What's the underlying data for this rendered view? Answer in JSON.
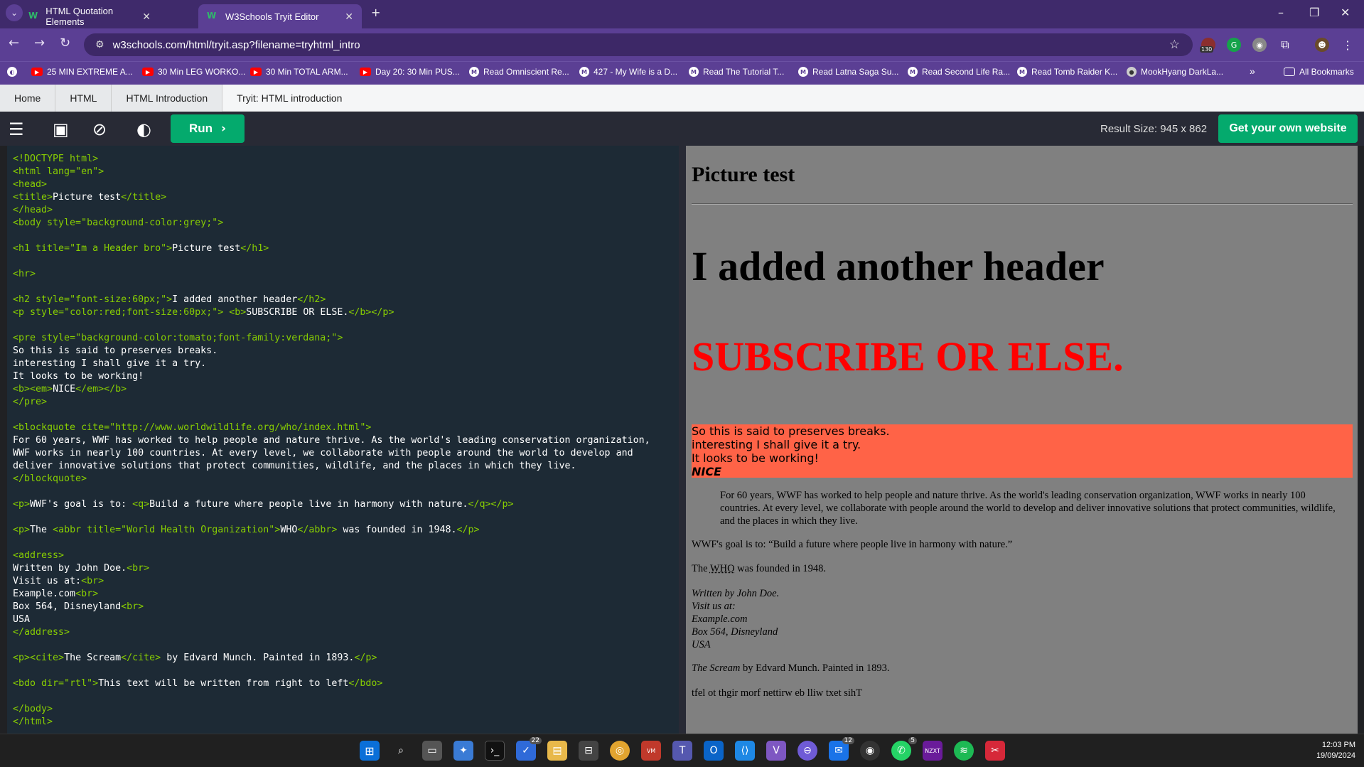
{
  "tabs": [
    {
      "label": "HTML Quotation Elements",
      "active": false
    },
    {
      "label": "W3Schools Tryit Editor",
      "active": true
    }
  ],
  "window_controls": {
    "new_tab": "+",
    "minimize": "–",
    "restore": "❐",
    "close": "✕"
  },
  "toolbar": {
    "url": "w3schools.com/html/tryit.asp?filename=tryhtml_intro",
    "extension_badge": "130"
  },
  "bookmarks": [
    {
      "label": "25 MIN EXTREME A...",
      "icon": "youtube-icon"
    },
    {
      "label": "30 Min LEG WORKO...",
      "icon": "youtube-icon"
    },
    {
      "label": "30 Min TOTAL ARM...",
      "icon": "youtube-icon"
    },
    {
      "label": "Day 20: 30 Min PUS...",
      "icon": "youtube-icon"
    },
    {
      "label": "Read Omniscient Re...",
      "icon": "manga-icon"
    },
    {
      "label": "427 - My Wife is a D...",
      "icon": "manga-icon"
    },
    {
      "label": "Read The Tutorial T...",
      "icon": "manga-icon"
    },
    {
      "label": "Read Latna Saga Su...",
      "icon": "manga-icon"
    },
    {
      "label": "Read Second Life Ra...",
      "icon": "manga-icon"
    },
    {
      "label": "Read Tomb Raider K...",
      "icon": "manga-icon"
    },
    {
      "label": "MookHyang DarkLa...",
      "icon": "site-icon"
    }
  ],
  "bookmarks_overflow": "»",
  "all_bookmarks": "All Bookmarks",
  "breadcrumb": [
    "Home",
    "HTML",
    "HTML Introduction",
    "Tryit: HTML introduction"
  ],
  "editor": {
    "run_label": "Run",
    "result_size": "Result Size: 945 x 862",
    "get_website": "Get your own website"
  },
  "code_lines": [
    "<!DOCTYPE html>",
    "<html lang=\"en\">",
    "<head>",
    "<title>Picture test</title>",
    "</head>",
    "<body style=\"background-color:grey;\">",
    "",
    "<h1 title=\"Im a Header bro\">Picture test</h1>",
    "",
    "<hr>",
    "",
    "<h2 style=\"font-size:60px;\">I added another header</h2>",
    "<p style=\"color:red;font-size:60px;\"> <b>SUBSCRIBE OR ELSE.</b></p>",
    "",
    "<pre style=\"background-color:tomato;font-family:verdana;\">",
    "So this is said to preserves breaks.",
    "interesting I shall give it a try.",
    "It looks to be working!",
    "<b><em>NICE</em></b>",
    "</pre>",
    "",
    "<blockquote cite=\"http://www.worldwildlife.org/who/index.html\">",
    "For 60 years, WWF has worked to help people and nature thrive. As the world's leading conservation organization,",
    "WWF works in nearly 100 countries. At every level, we collaborate with people around the world to develop and",
    "deliver innovative solutions that protect communities, wildlife, and the places in which they live.",
    "</blockquote>",
    "",
    "<p>WWF's goal is to: <q>Build a future where people live in harmony with nature.</q></p>",
    "",
    "<p>The <abbr title=\"World Health Organization\">WHO</abbr> was founded in 1948.</p>",
    "",
    "<address>",
    "Written by John Doe.<br>",
    "Visit us at:<br>",
    "Example.com<br>",
    "Box 564, Disneyland<br>",
    "USA",
    "</address>",
    "",
    "<p><cite>The Scream</cite> by Edvard Munch. Painted in 1893.</p>",
    "",
    "<bdo dir=\"rtl\">This text will be written from right to left</bdo>",
    "",
    "</body>",
    "</html>"
  ],
  "result": {
    "h1": "Picture test",
    "h2": "I added another header",
    "subscribe": "SUBSCRIBE OR ELSE.",
    "pre_lines": [
      "So this is said to preserves breaks.",
      "interesting I shall give it a try.",
      "It looks to be working!"
    ],
    "pre_nice": "NICE",
    "blockquote": "For 60 years, WWF has worked to help people and nature thrive. As the world's leading conservation organization, WWF works in nearly 100 countries. At every level, we collaborate with people around the world to develop and deliver innovative solutions that protect communities, wildlife, and the places in which they live.",
    "goal_prefix": "WWF's goal is to: ",
    "goal_quote": "“Build a future where people live in harmony with nature.”",
    "who_prefix": "The ",
    "who_abbr": "WHO",
    "who_suffix": " was founded in 1948.",
    "address": [
      "Written by John Doe.",
      "Visit us at:",
      "Example.com",
      "Box 564, Disneyland",
      "USA"
    ],
    "cite": "The Scream",
    "cite_suffix": " by Edvard Munch. Painted in 1893.",
    "bdo": "tfel ot thgir morf nettirw eb lliw txet sihT"
  },
  "taskbar": {
    "badges": {
      "tasks": "22",
      "mail": "12",
      "whatsapp": "5"
    },
    "time": "12:03 PM",
    "date": "19/09/2024"
  },
  "colors": {
    "browser_purple": "#5b3f94",
    "w3_green": "#04aa6d",
    "code_bg": "#1d2a35",
    "result_bg": "#808080",
    "tomato": "#ff6347",
    "red": "#ff0000"
  }
}
